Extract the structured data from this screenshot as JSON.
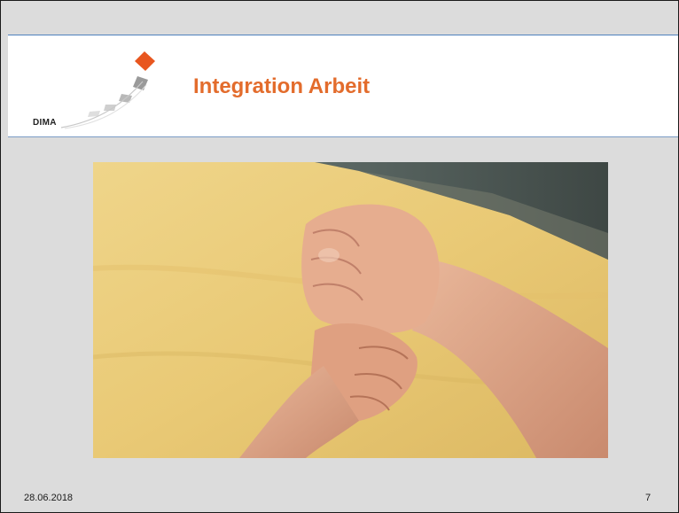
{
  "header": {
    "title": "Integration Arbeit",
    "logo_text": "DIMA",
    "title_color": "#e36c2c"
  },
  "photo": {
    "icon": "hands-fists-photo"
  },
  "footer": {
    "date": "28.06.2018",
    "page_number": "7"
  }
}
